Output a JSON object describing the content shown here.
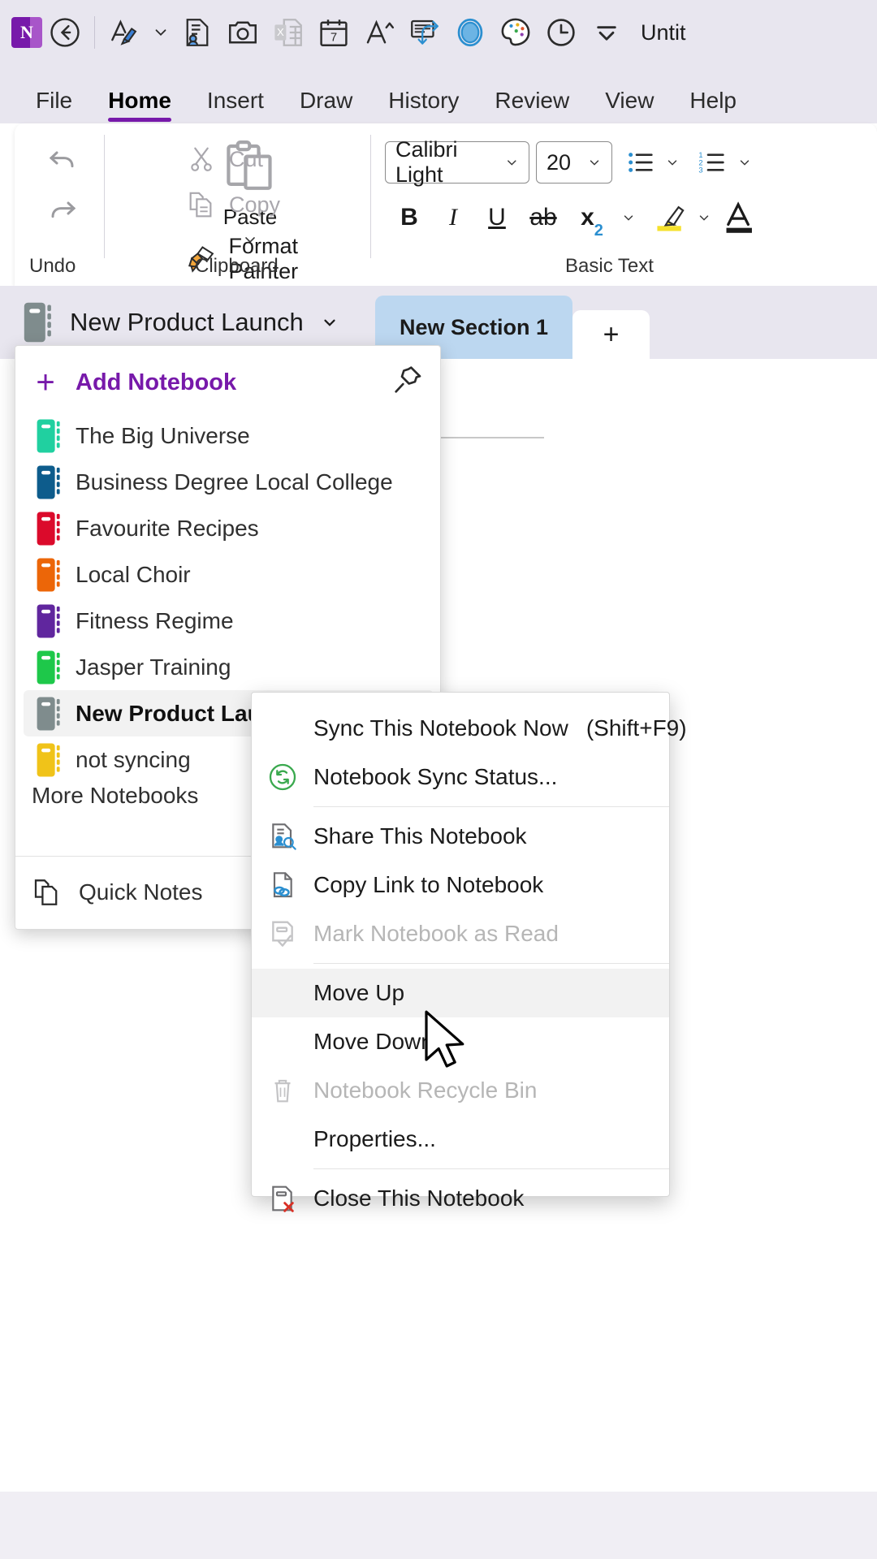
{
  "quick_access": {
    "app_logo": "onenote-logo",
    "buttons": [
      {
        "name": "back-button",
        "icon": "back-arrow-icon"
      },
      {
        "name": "ink-tools-button",
        "icon": "pen-highlighter-icon"
      },
      {
        "name": "ink-dropdown-button",
        "icon": "chevron-down-icon"
      },
      {
        "name": "researcher-button",
        "icon": "document-person-icon"
      },
      {
        "name": "screen-clipping-button",
        "icon": "camera-icon"
      },
      {
        "name": "excel-spreadsheet-button",
        "icon": "excel-file-icon"
      },
      {
        "name": "meeting-details-button",
        "icon": "calendar-7-icon"
      },
      {
        "name": "text-size-button",
        "icon": "font-size-up-icon"
      },
      {
        "name": "send-to-button",
        "icon": "send-to-grid-icon"
      },
      {
        "name": "ink-color-button",
        "icon": "blue-circle-icon"
      },
      {
        "name": "theme-palette-button",
        "icon": "palette-icon"
      },
      {
        "name": "recent-button",
        "icon": "clock-icon"
      },
      {
        "name": "customize-toolbar-button",
        "icon": "chevron-down-bar-icon"
      }
    ],
    "document_title": "Untit"
  },
  "ribbon": {
    "tabs": [
      {
        "label": "File",
        "active": false
      },
      {
        "label": "Home",
        "active": true
      },
      {
        "label": "Insert",
        "active": false
      },
      {
        "label": "Draw",
        "active": false
      },
      {
        "label": "History",
        "active": false
      },
      {
        "label": "Review",
        "active": false
      },
      {
        "label": "View",
        "active": false
      },
      {
        "label": "Help",
        "active": false
      }
    ],
    "groups": {
      "undo": {
        "label": "Undo",
        "undo_icon": "undo-arrow-icon",
        "redo_icon": "redo-arrow-icon"
      },
      "clipboard": {
        "label": "Clipboard",
        "paste_label": "Paste",
        "paste_icon": "clipboard-icon",
        "paste_chevron": "chevron-down-icon",
        "cut_label": "Cut",
        "cut_icon": "scissors-icon",
        "copy_label": "Copy",
        "copy_icon": "copy-pages-icon",
        "format_painter_label": "Format Painter",
        "format_painter_icon": "paint-brush-icon"
      },
      "basic_text": {
        "label": "Basic Text",
        "font_family": "Calibri Light",
        "font_size": "20",
        "bold_label": "B",
        "italic_label": "I",
        "underline_label": "U",
        "strikethrough_label": "ab",
        "subscript_label": "x",
        "subscript_sub": "2",
        "bullets_icon": "bullet-list-icon",
        "numbering_icon": "numbered-list-icon",
        "highlight_icon": "text-highlight-icon",
        "font_color_icon": "font-color-icon"
      }
    }
  },
  "notebook_bar": {
    "notebook_icon": "notebook-gray-icon",
    "notebook_name": "New Product Launch",
    "chevron": "chevron-down-icon"
  },
  "sections": {
    "tabs": [
      {
        "label": "New Section 1",
        "active": true
      }
    ],
    "add_label": "+"
  },
  "notebook_panel": {
    "add_notebook_label": "Add Notebook",
    "add_icon": "plus-icon",
    "pin_icon": "pin-icon",
    "notebooks": [
      {
        "label": "The Big Universe",
        "color": "#20d0a0",
        "selected": false
      },
      {
        "label": "Business Degree Local College",
        "color": "#0d5c8c",
        "selected": false
      },
      {
        "label": "Favourite Recipes",
        "color": "#db0a2b",
        "selected": false
      },
      {
        "label": "Local Choir",
        "color": "#ec6608",
        "selected": false
      },
      {
        "label": "Fitness Regime",
        "color": "#60269e",
        "selected": false
      },
      {
        "label": "Jasper Training",
        "color": "#1ec84a",
        "selected": false
      },
      {
        "label": "New Product Launch",
        "color": "#7f8c8d",
        "selected": true
      },
      {
        "label": "not syncing",
        "color": "#f0c319",
        "selected": false
      }
    ],
    "more_notebooks_label": "More Notebooks",
    "quick_notes_label": "Quick Notes",
    "quick_notes_icon": "quick-notes-pages-icon"
  },
  "context_menu": {
    "items": [
      {
        "label": "Sync This Notebook Now",
        "accel": "S",
        "shortcut": "(Shift+F9)",
        "icon": null,
        "disabled": false,
        "highlighted": false
      },
      {
        "label": "Notebook Sync Status...",
        "accel": "N",
        "shortcut": "",
        "icon": "sync-status-icon",
        "disabled": false,
        "highlighted": false
      },
      {
        "separator": true
      },
      {
        "label": "Share This Notebook",
        "accel": "T",
        "shortcut": "",
        "icon": "share-notebook-icon",
        "disabled": false,
        "highlighted": false
      },
      {
        "label": "Copy Link to Notebook",
        "accel": "L",
        "shortcut": "",
        "icon": "copy-link-icon",
        "disabled": false,
        "highlighted": false
      },
      {
        "label": "Mark Notebook as Read",
        "accel": "k",
        "shortcut": "",
        "icon": "mark-read-icon",
        "disabled": true,
        "highlighted": false
      },
      {
        "separator": true
      },
      {
        "label": "Move Up",
        "accel": "U",
        "shortcut": "",
        "icon": null,
        "disabled": false,
        "highlighted": true
      },
      {
        "label": "Move Down",
        "accel": "D",
        "shortcut": "",
        "icon": null,
        "disabled": false,
        "highlighted": false
      },
      {
        "label": "Notebook Recycle Bin",
        "accel": "R",
        "shortcut": "",
        "icon": "recycle-bin-icon",
        "disabled": true,
        "highlighted": false
      },
      {
        "label": "Properties...",
        "accel": "P",
        "shortcut": "",
        "icon": null,
        "disabled": false,
        "highlighted": false
      },
      {
        "separator": true
      },
      {
        "label": "Close This Notebook",
        "accel": "C",
        "shortcut": "",
        "icon": "close-notebook-icon",
        "disabled": false,
        "highlighted": false
      }
    ]
  },
  "cursor": {
    "icon": "mouse-pointer-icon"
  }
}
